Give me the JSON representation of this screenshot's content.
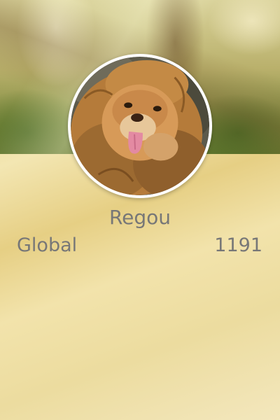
{
  "profile": {
    "username": "Regou",
    "avatar_icon": "lion-avatar-icon"
  },
  "stats": {
    "label": "Global",
    "value": "1191"
  },
  "colors": {
    "text": "#777777",
    "avatar_border": "#ffffff"
  }
}
